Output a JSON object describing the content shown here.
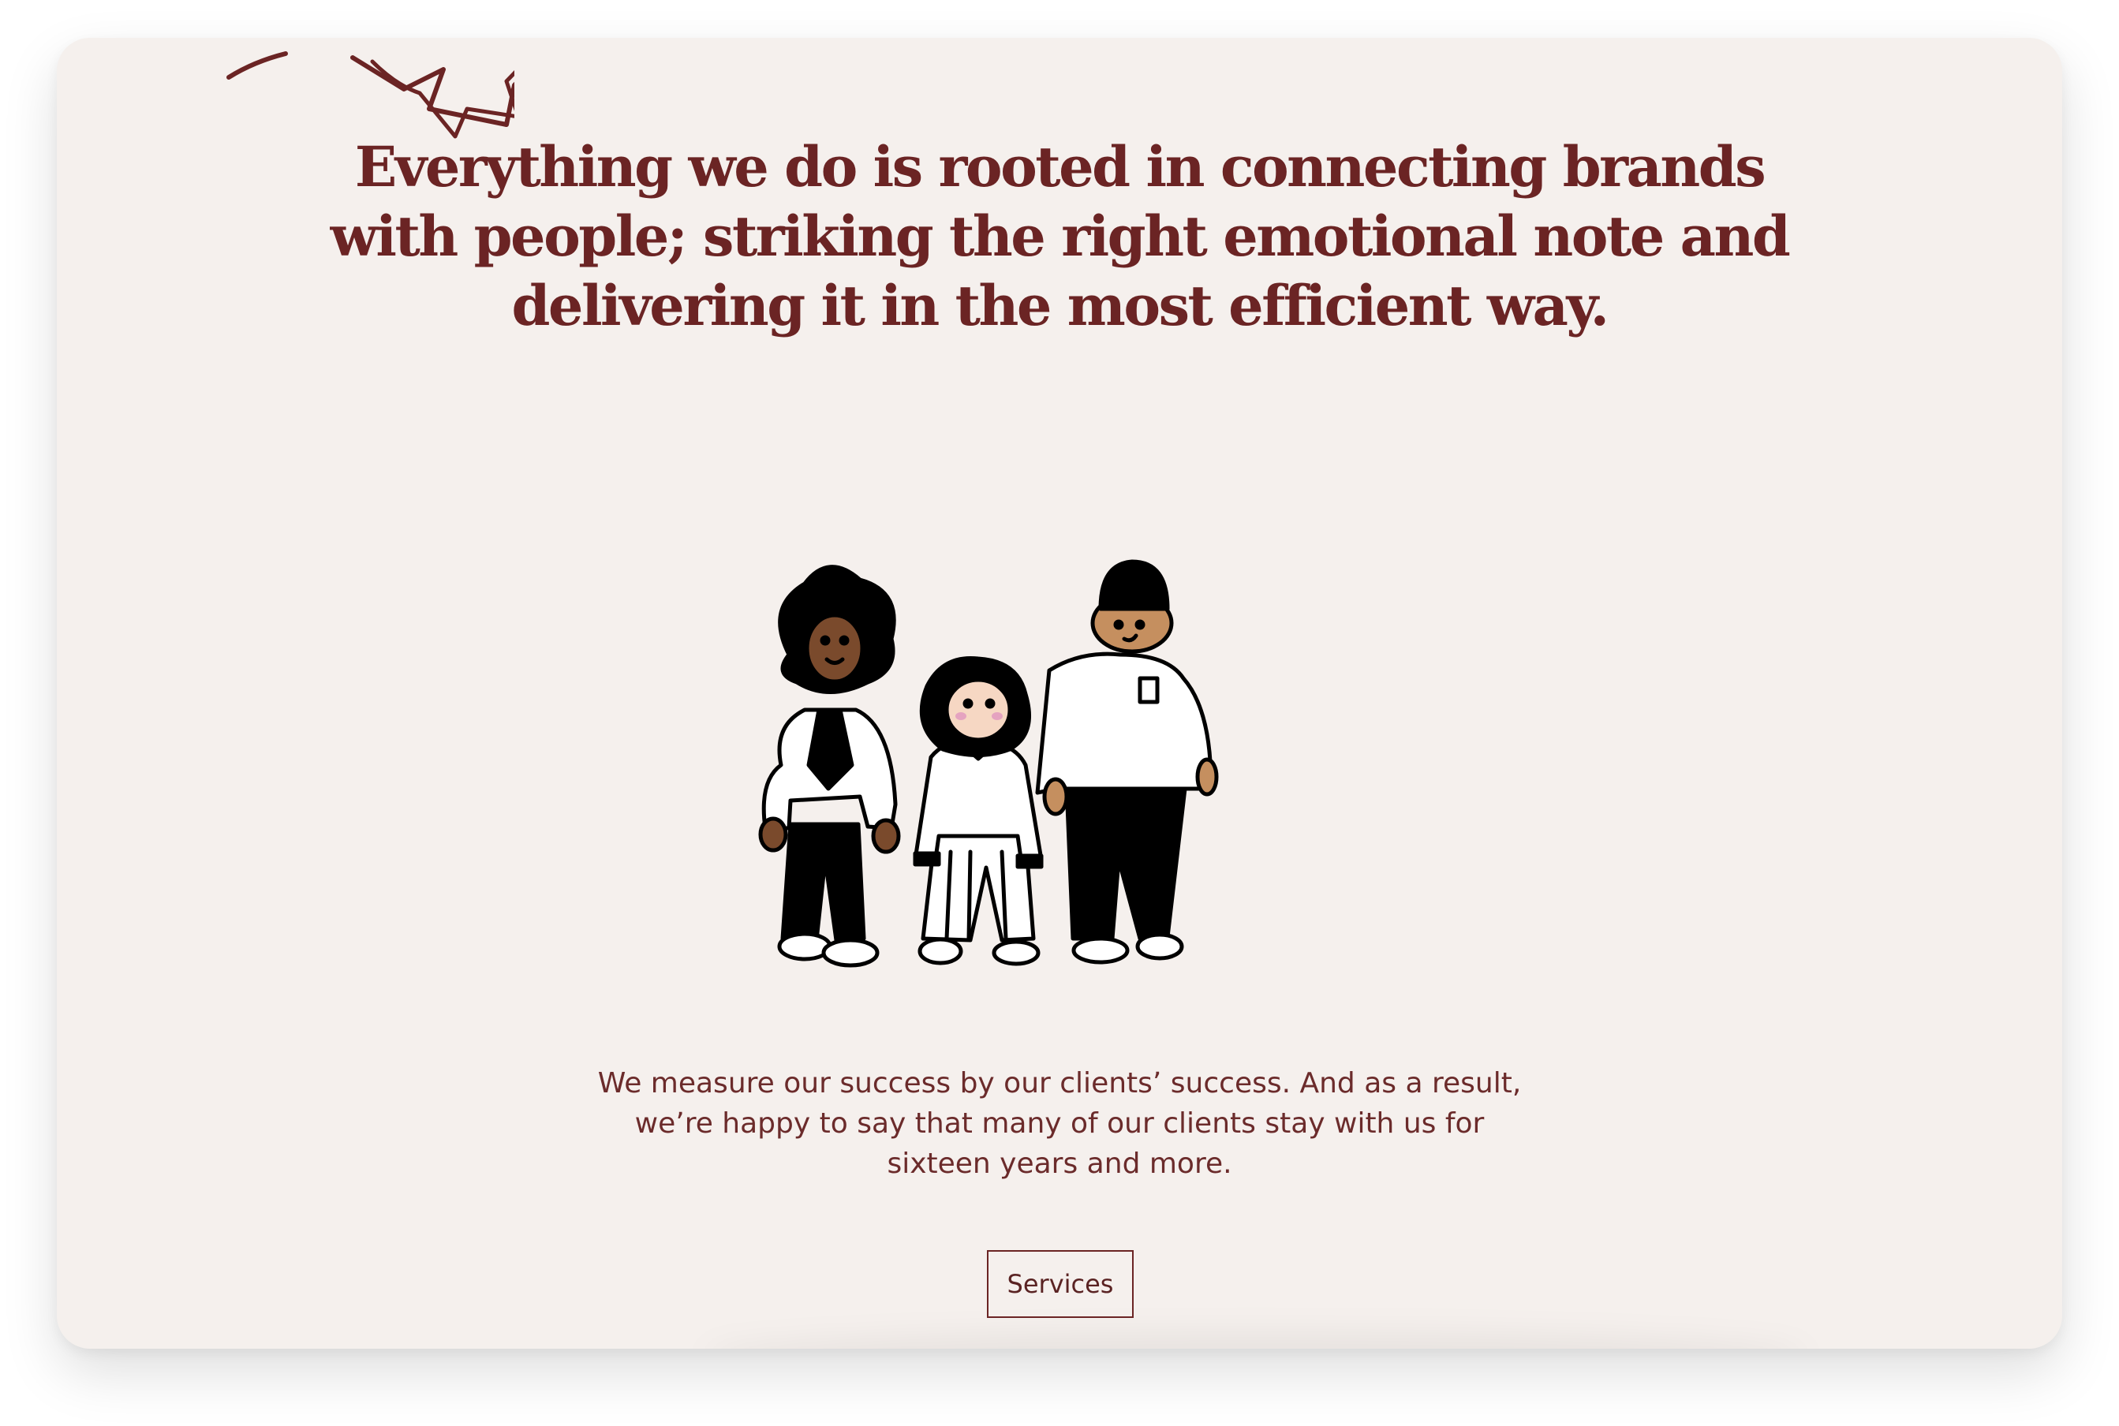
{
  "headline": {
    "lines": [
      "Everything we do is rooted in connecting brands",
      "with people; striking the right emotional note and",
      "delivering it in the most efficient way."
    ]
  },
  "body": {
    "lines": [
      "We measure our success by our clients’ success. And as a result,",
      "we’re happy to say that many of our clients stay with us for",
      "sixteen years and more."
    ]
  },
  "cta": {
    "label": "Services"
  },
  "colors": {
    "background": "#f5f0ed",
    "accent": "#6b2424",
    "ink": "#000000"
  },
  "icons": {
    "decoration": "star-doodle-icon",
    "illustration": "three-people-illustration"
  }
}
